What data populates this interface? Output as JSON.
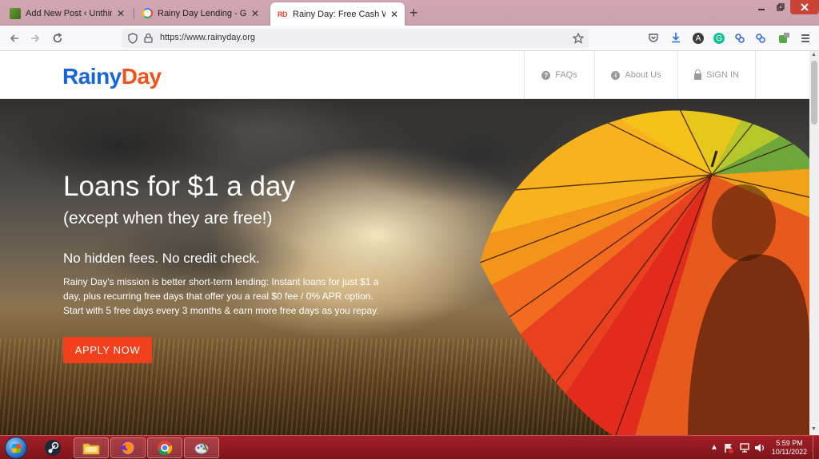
{
  "browser": {
    "tabs": [
      {
        "title": "Add New Post ‹ Unthinkable —",
        "favicon": "wordpress-favicon",
        "active": false
      },
      {
        "title": "Rainy Day Lending - Google Sea",
        "favicon": "google-favicon",
        "active": false
      },
      {
        "title": "Rainy Day: Free Cash When You",
        "favicon": "rainyday-favicon",
        "active": true
      }
    ],
    "rd_favicon_text": "RD",
    "new_tab_glyph": "+",
    "close_glyph": "✕",
    "url": "https://www.rainyday.org"
  },
  "site": {
    "logo": {
      "part1": "Rainy",
      "part2": "Day"
    },
    "nav": {
      "faqs": "FAQs",
      "about": "About Us",
      "signin": "SIGN IN"
    },
    "hero": {
      "title": "Loans for $1 a day",
      "subtitle": "(except when they are free!)",
      "tagline": "No hidden fees. No credit check.",
      "description": "Rainy Day's mission is better short-term lending: Instant loans for just $1 a day, plus recurring free days that offer you a real $0 fee / 0% APR option. Start with 5 free days every 3 months & earn more free days as you repay.",
      "cta": "APPLY NOW"
    }
  },
  "taskbar": {
    "time": "5:59 PM",
    "date": "10/11/2022"
  },
  "colors": {
    "logo_blue": "#1565d8",
    "logo_orange": "#f2511b",
    "cta_red": "#f2401c",
    "taskbar": "#8e1a20"
  }
}
